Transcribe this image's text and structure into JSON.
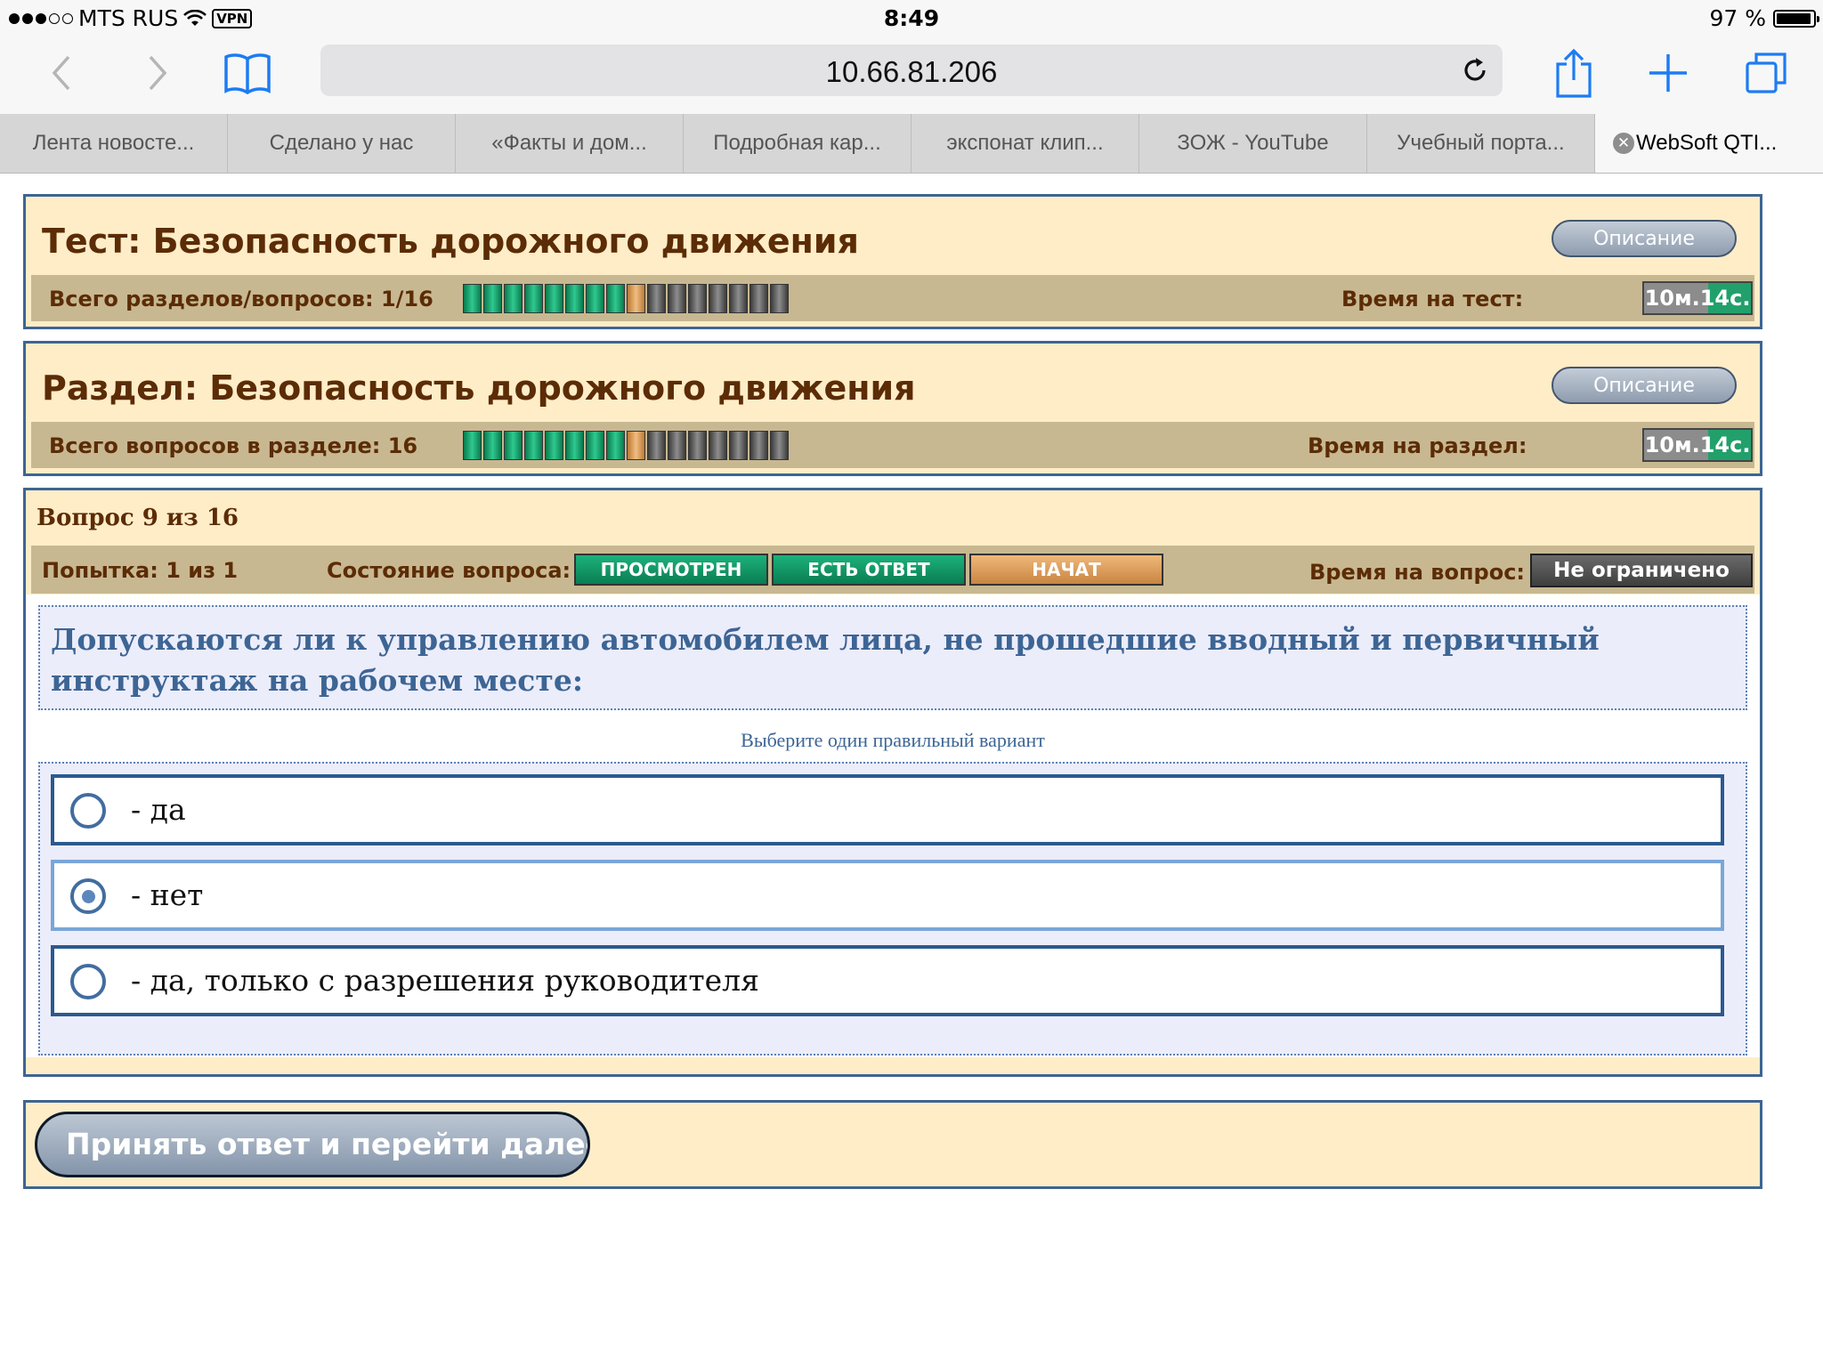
{
  "status_bar": {
    "carrier": "MTS RUS",
    "vpn": "VPN",
    "time": "8:49",
    "battery": "97 %"
  },
  "browser": {
    "url": "10.66.81.206",
    "icons": [
      "back-icon",
      "forward-icon",
      "bookmarks-icon",
      "reload-icon",
      "share-icon",
      "new-tab-icon",
      "tabs-icon"
    ],
    "tabs": [
      {
        "label": "Лента новосте..."
      },
      {
        "label": "Сделано у нас"
      },
      {
        "label": "«Факты и дом..."
      },
      {
        "label": "Подробная кар..."
      },
      {
        "label": "экспонат клип..."
      },
      {
        "label": "ЗОЖ - YouTube"
      },
      {
        "label": "Учебный порта..."
      },
      {
        "label": "WebSoft QTI..."
      }
    ]
  },
  "test": {
    "title": "Тест: Безопасность дорожного движения",
    "description_button": "Описание",
    "sections_label": "Всего разделов/вопросов: 1/16",
    "time_label": "Время на тест:",
    "timer": "10м.14с."
  },
  "section": {
    "title": "Раздел: Безопасность дорожного движения",
    "description_button": "Описание",
    "questions_label": "Всего вопросов в разделе: 16",
    "time_label": "Время на раздел:",
    "timer": "10м.14с."
  },
  "progress": {
    "total": 16,
    "answered": 8,
    "current": 9
  },
  "question": {
    "number_label": "Вопрос 9 из 16",
    "attempt_label": "Попытка: 1 из 1",
    "state_label": "Состояние вопроса:",
    "states": [
      "ПРОСМОТРЕН",
      "ЕСТЬ ОТВЕТ",
      "НАЧАТ"
    ],
    "time_label": "Время на вопрос:",
    "time_value": "Не ограничено",
    "text": "Допускаются ли к управлению автомобилем лица, не прошедшие вводный и первичный инструктаж на рабочем месте:",
    "hint": "Выберите один правильный вариант",
    "answers": [
      {
        "text": "- да",
        "selected": false
      },
      {
        "text": "- нет",
        "selected": true
      },
      {
        "text": "- да, только с разрешения руководителя",
        "selected": false
      }
    ]
  },
  "submit": {
    "label": "Принять ответ и перейти далее"
  },
  "colors": {
    "panel_bg": "#ffedc8",
    "panel_border": "#3d6594",
    "info_bar": "#c8b891",
    "title_brown": "#5b2c06",
    "answered_green": "#1cb27a",
    "current_orange": "#f0b879",
    "pending_gray": "#6a6a6a"
  }
}
